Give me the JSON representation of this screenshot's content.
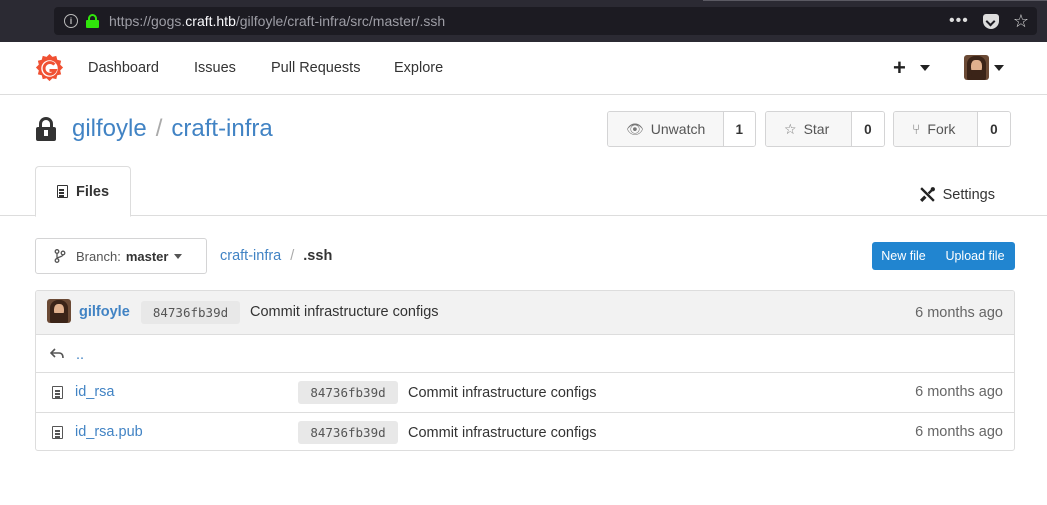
{
  "browser": {
    "url_prefix": "https://gogs.",
    "url_host": "craft.htb",
    "url_path": "/gilfoyle/craft-infra/src/master/.ssh",
    "menu_dots": "•••"
  },
  "nav": {
    "items": [
      "Dashboard",
      "Issues",
      "Pull Requests",
      "Explore"
    ],
    "create_label": "+"
  },
  "repo": {
    "owner": "gilfoyle",
    "separator": "/",
    "name": "craft-infra",
    "watch": {
      "label": "Unwatch",
      "count": "1"
    },
    "star": {
      "label": "Star",
      "count": "0"
    },
    "fork": {
      "label": "Fork",
      "count": "0"
    },
    "tabs": {
      "files": "Files",
      "settings": "Settings"
    }
  },
  "branch": {
    "label": "Branch:",
    "name": "master"
  },
  "breadcrumb": {
    "root": "craft-infra",
    "separator": "/",
    "current": ".ssh"
  },
  "actions": {
    "new_file": "New file",
    "upload_file": "Upload file"
  },
  "latest_commit": {
    "author": "gilfoyle",
    "sha": "84736fb39d",
    "message": "Commit infrastructure configs",
    "age": "6 months ago"
  },
  "parent_dir": "..",
  "files": [
    {
      "name": "id_rsa",
      "sha": "84736fb39d",
      "message": "Commit infrastructure configs",
      "age": "6 months ago"
    },
    {
      "name": "id_rsa.pub",
      "sha": "84736fb39d",
      "message": "Commit infrastructure configs",
      "age": "6 months ago"
    }
  ]
}
